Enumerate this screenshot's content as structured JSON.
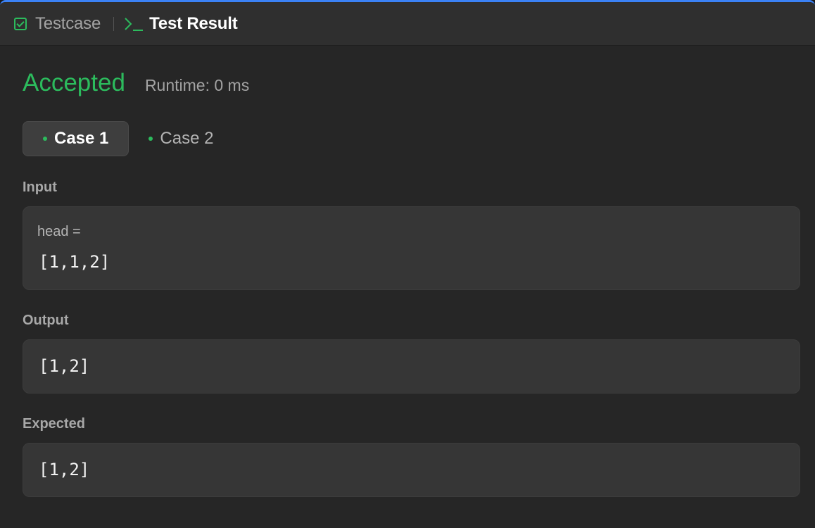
{
  "tabs": {
    "testcase_label": "Testcase",
    "test_result_label": "Test Result"
  },
  "result": {
    "status": "Accepted",
    "runtime": "Runtime: 0 ms"
  },
  "cases": [
    {
      "label": "Case 1",
      "selected": true
    },
    {
      "label": "Case 2",
      "selected": false
    }
  ],
  "input": {
    "section_label": "Input",
    "var_name": "head =",
    "value": "[1,1,2]"
  },
  "output": {
    "section_label": "Output",
    "value": "[1,2]"
  },
  "expected": {
    "section_label": "Expected",
    "value": "[1,2]"
  },
  "colors": {
    "accent_green": "#2cbb5d",
    "top_border_blue": "#3b82f6"
  },
  "icons": {
    "testcase": "checkbox-icon",
    "test_result": "terminal-icon"
  }
}
